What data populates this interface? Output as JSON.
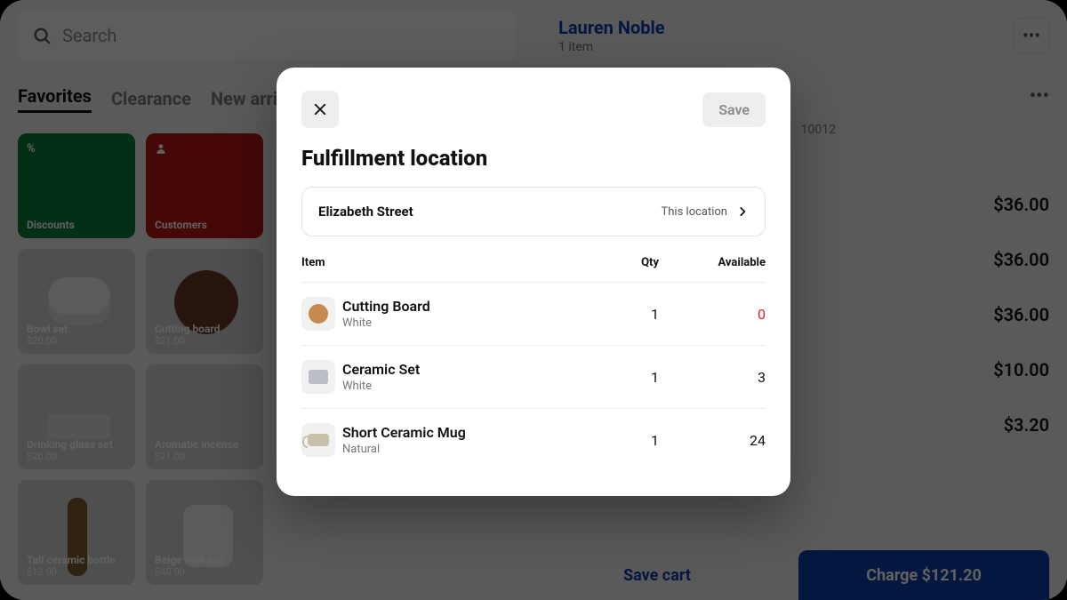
{
  "header": {
    "search_placeholder": "Search",
    "customer_name": "Lauren Noble",
    "customer_sub": "1 item",
    "more": "•••",
    "address_fragment": "10012"
  },
  "tabs": {
    "t1": "Favorites",
    "t2": "Clearance",
    "t3": "New arriva"
  },
  "tiles": {
    "discounts": {
      "label": "Discounts",
      "icon": "%"
    },
    "customers": {
      "label": "Customers"
    },
    "bowl": {
      "label": "Bowl set",
      "price": "$20.00"
    },
    "board": {
      "label": "Cutting board",
      "price": "$21.00"
    },
    "glass": {
      "label": "Drinking glass set",
      "price": "$20.00"
    },
    "incense": {
      "label": "Aromatic incense",
      "price": "$21.00"
    },
    "bottle": {
      "label": "Tall ceramic bottle",
      "price": "$12.00"
    },
    "jug": {
      "label": "Beige milk jug",
      "price": "$40.00"
    }
  },
  "prices": {
    "p1": "$36.00",
    "p2": "$36.00",
    "p3": "$36.00",
    "p4": "$10.00",
    "p5": "$3.20"
  },
  "footer": {
    "save": "Save cart",
    "charge": "Charge $121.20"
  },
  "modal": {
    "save": "Save",
    "title": "Fulfillment location",
    "location_name": "Elizabeth Street",
    "location_hint": "This location",
    "col_item": "Item",
    "col_qty": "Qty",
    "col_avail": "Available",
    "items": [
      {
        "name": "Cutting Board",
        "variant": "White",
        "qty": "1",
        "avail": "0",
        "zero": true
      },
      {
        "name": "Ceramic Set",
        "variant": "White",
        "qty": "1",
        "avail": "3",
        "zero": false
      },
      {
        "name": "Short Ceramic Mug",
        "variant": "Natural",
        "qty": "1",
        "avail": "24",
        "zero": false
      }
    ]
  }
}
